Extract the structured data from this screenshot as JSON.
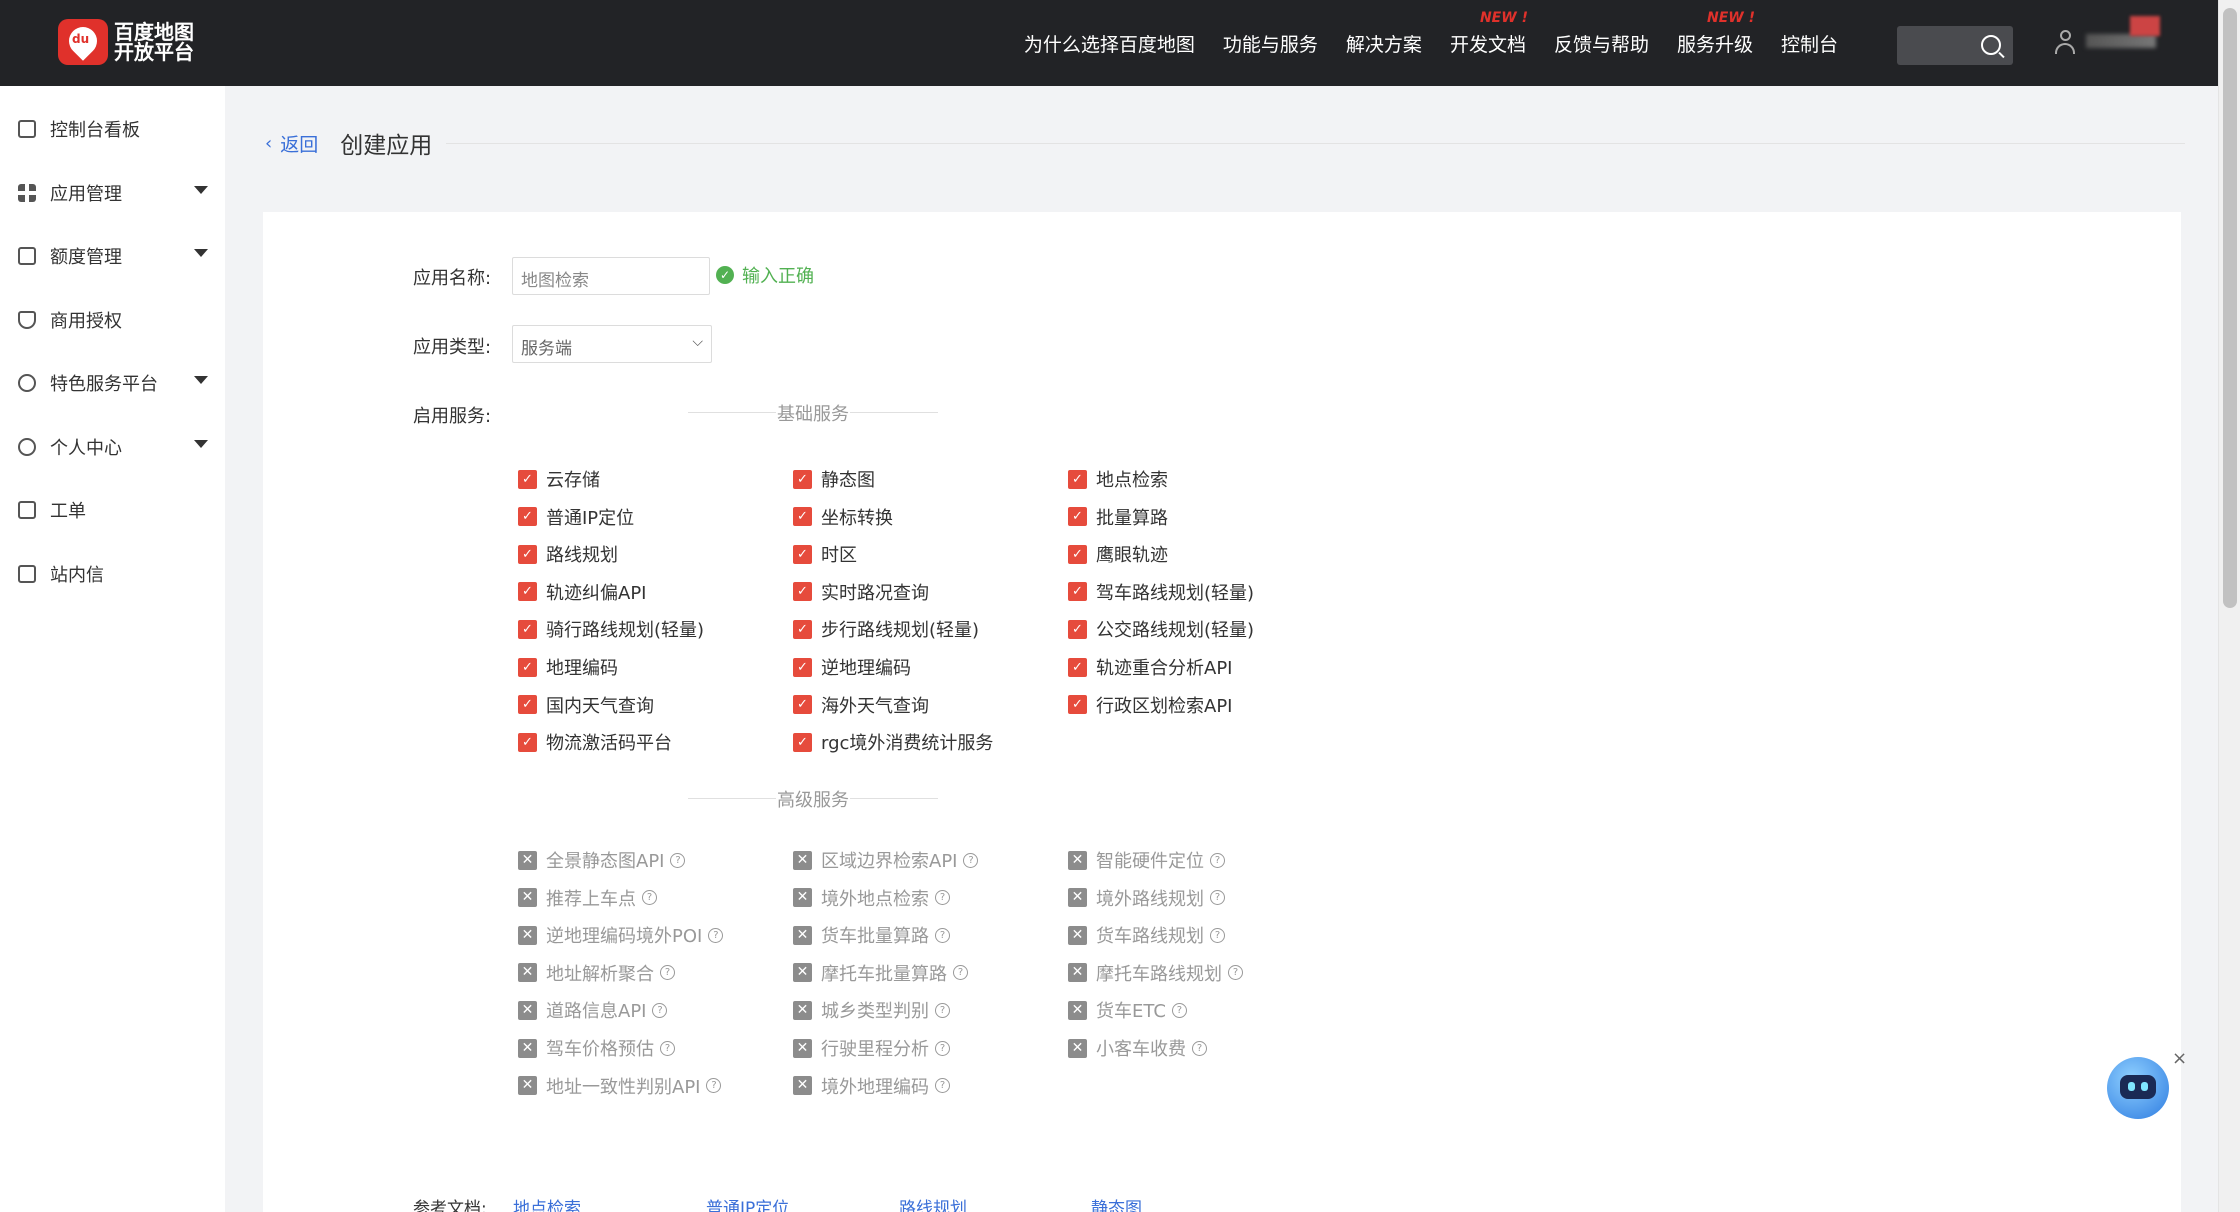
{
  "brand": {
    "line1": "百度地图",
    "line2": "开放平台",
    "mark": "du"
  },
  "nav": [
    {
      "label": "为什么选择百度地图",
      "new": ""
    },
    {
      "label": "功能与服务",
      "new": ""
    },
    {
      "label": "解决方案",
      "new": ""
    },
    {
      "label": "开发文档",
      "new": "NEW !"
    },
    {
      "label": "反馈与帮助",
      "new": ""
    },
    {
      "label": "服务升级",
      "new": "NEW !"
    },
    {
      "label": "控制台",
      "new": ""
    }
  ],
  "sidebar": [
    {
      "label": "控制台看板",
      "icon": "dashboard-icon",
      "expandable": false
    },
    {
      "label": "应用管理",
      "icon": "grid-icon",
      "expandable": true
    },
    {
      "label": "额度管理",
      "icon": "sliders-icon",
      "expandable": true
    },
    {
      "label": "商用授权",
      "icon": "shield-icon",
      "expandable": false
    },
    {
      "label": "特色服务平台",
      "icon": "heart-icon",
      "expandable": true
    },
    {
      "label": "个人中心",
      "icon": "user-circle-icon",
      "expandable": true
    },
    {
      "label": "工单",
      "icon": "clipboard-icon",
      "expandable": false
    },
    {
      "label": "站内信",
      "icon": "mail-icon",
      "expandable": false
    }
  ],
  "breadcrumb": {
    "back": "返回",
    "title": "创建应用"
  },
  "form": {
    "name_label": "应用名称:",
    "name_value": "地图检索",
    "name_status": "输入正确",
    "type_label": "应用类型:",
    "type_value": "服务端",
    "services_label": "启用服务:"
  },
  "basic_title": "基础服务",
  "basic_services": [
    "云存储",
    "静态图",
    "地点检索",
    "普通IP定位",
    "坐标转换",
    "批量算路",
    "路线规划",
    "时区",
    "鹰眼轨迹",
    "轨迹纠偏API",
    "实时路况查询",
    "驾车路线规划(轻量)",
    "骑行路线规划(轻量)",
    "步行路线规划(轻量)",
    "公交路线规划(轻量)",
    "地理编码",
    "逆地理编码",
    "轨迹重合分析API",
    "国内天气查询",
    "海外天气查询",
    "行政区划检索API",
    "物流激活码平台",
    "rgc境外消费统计服务"
  ],
  "advanced_title": "高级服务",
  "advanced_services": [
    "全景静态图API",
    "区域边界检索API",
    "智能硬件定位",
    "推荐上车点",
    "境外地点检索",
    "境外路线规划",
    "逆地理编码境外POI",
    "货车批量算路",
    "货车路线规划",
    "地址解析聚合",
    "摩托车批量算路",
    "摩托车路线规划",
    "道路信息API",
    "城乡类型判别",
    "货车ETC",
    "驾车价格预估",
    "行驶里程分析",
    "小客车收费",
    "地址一致性判别API",
    "境外地理编码"
  ],
  "references": {
    "label": "参考文档:",
    "links": [
      "地点检索",
      "普通IP定位",
      "路线规划",
      "静态图"
    ]
  },
  "colors": {
    "accent": "#e64b3c",
    "link": "#3a6fd8",
    "success": "#52b152",
    "topbar": "#222326"
  }
}
